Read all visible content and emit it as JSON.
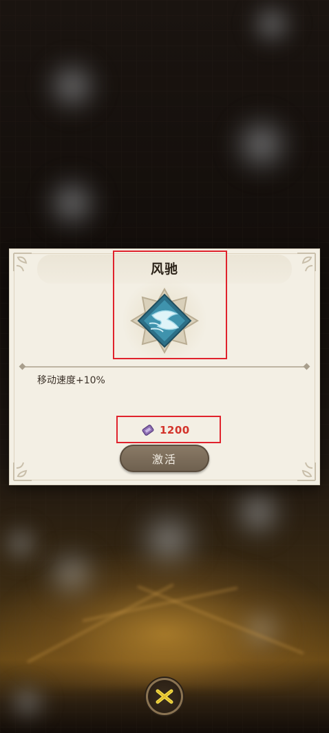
{
  "dialog": {
    "title": "风驰",
    "description": "移动速度+10%",
    "cost": {
      "icon": "ticket-icon",
      "value": "1200",
      "color": "#d3332a"
    },
    "activate_label": "激活"
  },
  "close": {
    "icon": "close-x-icon"
  },
  "colors": {
    "panel": "#f3efe4",
    "highlight": "#e0212b",
    "button": "#7a6b58"
  }
}
